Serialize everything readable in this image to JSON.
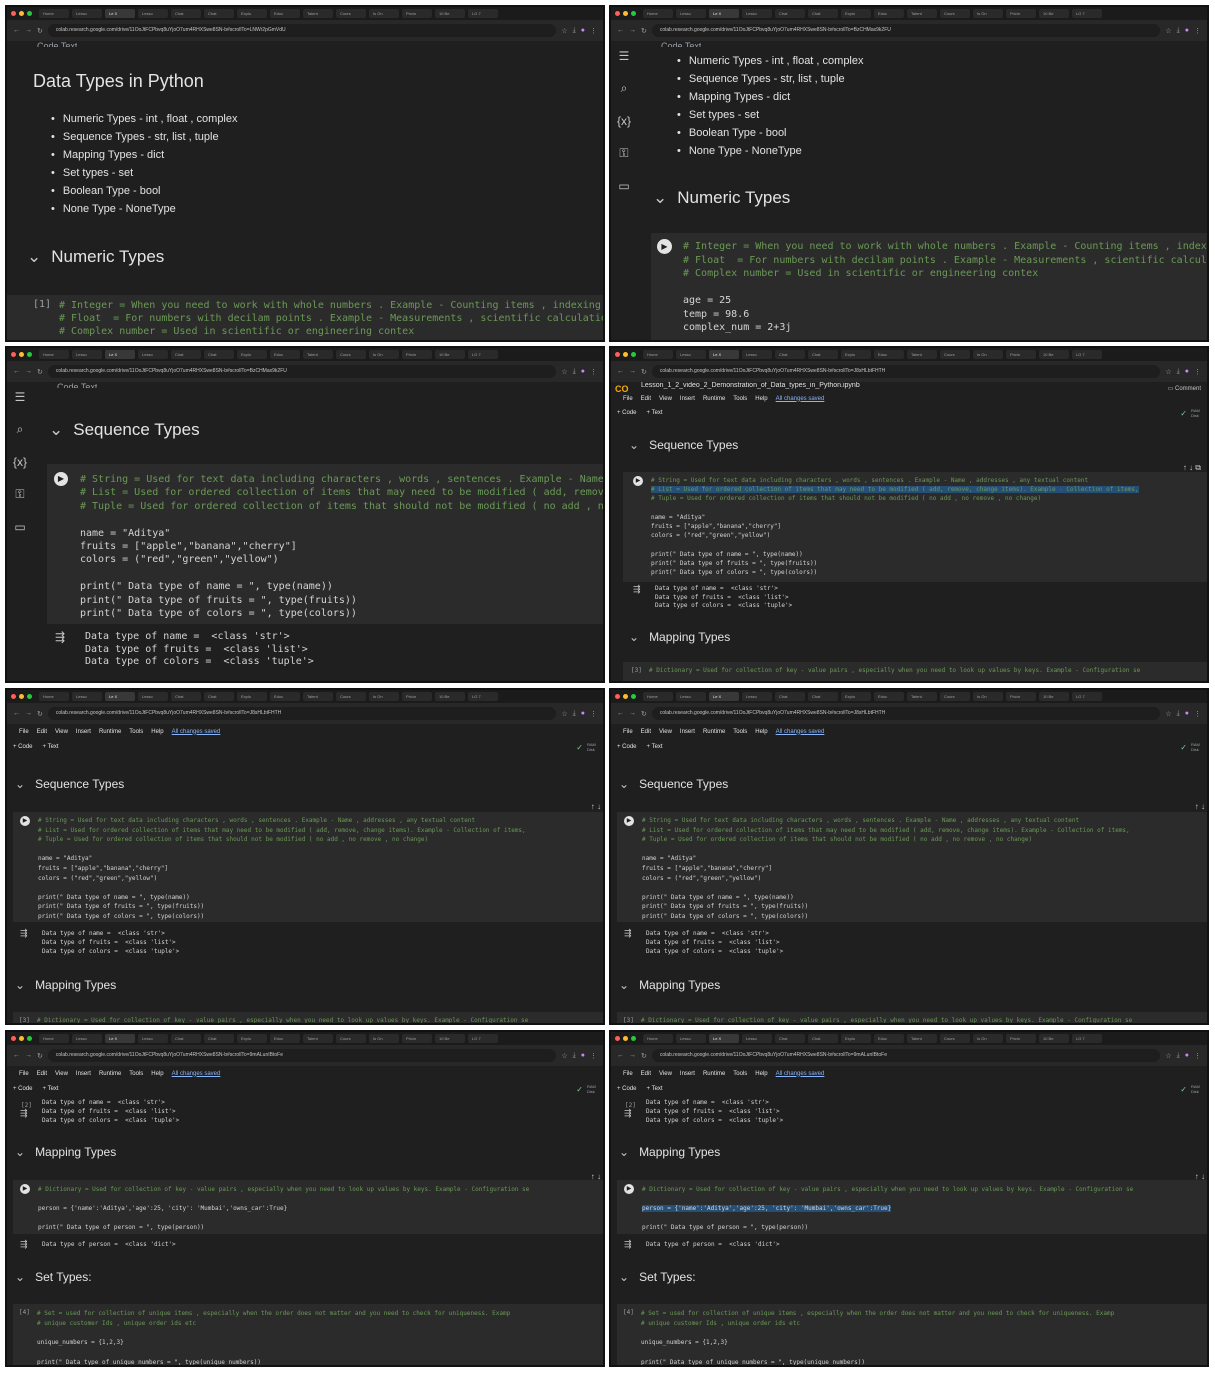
{
  "browser": {
    "tabs": [
      "Home",
      "Lesso",
      "Le X",
      "Lesso",
      "Chat",
      "Chat",
      "Explo",
      "Educ",
      "Talent",
      "Cours",
      "Is On",
      "Pricin",
      "10 Be",
      "LG 7",
      "Sams"
    ],
    "url_short": "colab.research.google.com/drive/11OoJtFCPbvq8uYjoO7um4RHXSwe8SN-b#scrollTo=LNWr2pGmVdU",
    "url_b": "colab.research.google.com/drive/11OoJtFCPbvq8uYjoO7um4RHXSwe8SN-b#scrollTo=BzCHMax9k2FU",
    "url_c": "colab.research.google.com/drive/11OoJtFCPbvq8uYjoO7um4RHXSwe8SN-b#scrollTo=J8sHLbtFHTH",
    "url_d": "colab.research.google.com/drive/11OoJtFCPbvq8uYjoO7um4RHXSwe8SN-b#scrollTo=9mALunIBtoFe"
  },
  "menu": {
    "items": [
      "File",
      "Edit",
      "View",
      "Insert",
      "Runtime",
      "Tools",
      "Help"
    ],
    "saved": "All changes saved"
  },
  "toolbar": {
    "code": "+ Code",
    "text": "+ Text",
    "ram": "RAM",
    "disk": "Disk"
  },
  "notebook_title": "Lesson_1_2_video_2_Demonstration_of_Data_types_in_Python.ipynb",
  "comment": "Comment",
  "top_fragment": "Code    Text",
  "heading": "Data Types in Python",
  "bullets": [
    "Numeric Types - int , float , complex",
    "Sequence Types - str, list , tuple",
    "Mapping Types - dict",
    "Set types - set",
    "Boolean Type - bool",
    "None Type - NoneType"
  ],
  "sections": {
    "numeric": "Numeric Types",
    "sequence": "Sequence Types",
    "mapping": "Mapping Types",
    "set": "Set Types:"
  },
  "cell_numbers": {
    "c1": "[1]",
    "c2": "[2]",
    "c3": "[3]",
    "c4": "[4]"
  },
  "numeric_code": {
    "c1": "# Integer = When you need to work with whole numbers . Example - Counting items , indexing",
    "c2": "# Float  = For numbers with decilam points . Example - Measurements , scientific calculations",
    "c3": "# Complex number = Used in scientific or engineering contex",
    "v1": "age = 25",
    "v2": "temp = 98.6",
    "v3": "complex_num = 2+3j"
  },
  "sequence_code": {
    "c1": "# String = Used for text data including characters , words , sentences . Example - Name , addresses , any textual content",
    "c2": "# List = Used for ordered collection of items that may need to be modified ( add, remove, change items). Example - Collection of items,",
    "c3": "# Tuple = Used for ordered collection of items that should not be modified ( no add , no remove , no change)",
    "v1": "name = \"Aditya\"",
    "v2": "fruits = [\"apple\",\"banana\",\"cherry\"]",
    "v3": "colors = (\"red\",\"green\",\"yellow\")",
    "p1": "print(\" Data type of name = \", type(name))",
    "p2": "print(\" Data type of fruits = \", type(fruits))",
    "p3": "print(\" Data type of colors = \", type(colors))",
    "o1": "Data type of name =  <class 'str'>",
    "o2": "Data type of fruits =  <class 'list'>",
    "o3": "Data type of colors =  <class 'tuple'>"
  },
  "mapping_code": {
    "c1": "# Dictionary = Used for collection of key - value pairs , especially when you need to look up values by keys. Example - Configuration se",
    "v1": "person = {'name':'Aditya','age':25, 'city': 'Mumbai','owns_car':True}",
    "p1": "print(\" Data type of person = \", type(person))",
    "o1": "Data type of person =  <class 'dict'>"
  },
  "set_code": {
    "c1": "# Set = used for collection of unique items , especially when the order does not matter and you need to check for uniqueness. Examp",
    "c2": "# unique customer Ids , unique order ids etc",
    "v1": "unique_numbers = {1,2,3}",
    "p1": "print(\" Data type of unique_numbers = \", type(unique_numbers))"
  },
  "icons": [
    "toc-icon",
    "search-icon",
    "variables-icon",
    "secrets-key-icon",
    "folder-icon",
    "run-icon",
    "output-icon",
    "chevron-down-icon"
  ]
}
